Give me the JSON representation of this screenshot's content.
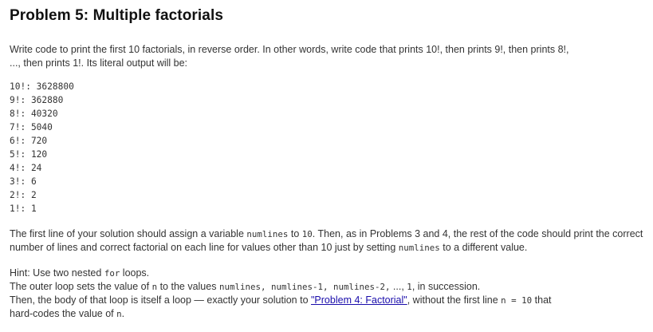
{
  "title": "Problem 5: Multiple factorials",
  "intro": {
    "line1": "Write code to print the first 10 factorials, in reverse order. In other words, write code that prints 10!, then prints 9!, then prints 8!,",
    "line2": "..., then prints 1!. Its literal output will be:"
  },
  "output_lines": [
    "10!: 3628800",
    "9!: 362880",
    "8!: 40320",
    "7!: 5040",
    "6!: 720",
    "5!: 120",
    "4!: 24",
    "3!: 6",
    "2!: 2",
    "1!: 1"
  ],
  "para2": {
    "t1": "The first line of your solution should assign a variable ",
    "c1": "numlines",
    "t2": " to ",
    "c2": "10",
    "t3": ". Then, as in Problems 3 and 4, the rest of the code should print the correct number of lines and correct factorial on each line for values other than 10 just by setting ",
    "c3": "numlines",
    "t4": " to a different value."
  },
  "hint": {
    "l1_t1": "Hint: Use two nested ",
    "l1_c1": "for",
    "l1_t2": " loops.",
    "l2_t1": "The outer loop sets the value of ",
    "l2_c1": "n",
    "l2_t2": " to the values ",
    "l2_c2": "numlines, numlines-1, numlines-2,",
    "l2_t3": " ..., ",
    "l2_c3": "1",
    "l2_t4": ", in succession.",
    "l3_t1": "Then, the body of that loop is itself a loop — exactly your solution to ",
    "l3_link": "\"Problem 4: Factorial\"",
    "l3_t2": ", without the first line ",
    "l3_c1": "n = 10",
    "l3_t3": " that",
    "l4_t1": "hard-codes the value of ",
    "l4_c1": "n",
    "l4_t2": "."
  }
}
